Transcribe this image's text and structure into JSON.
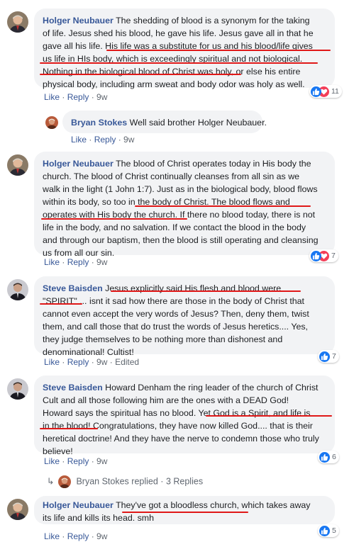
{
  "colors": {
    "author": "#385898",
    "bubble": "#f2f3f5",
    "like": "#1877f2",
    "love": "#f33e58",
    "underline": "#e01818"
  },
  "comments": [
    {
      "author": "Holger Neubauer",
      "lines": [
        "The shedding of blood is a synonym for the taking",
        "of life. Jesus shed his blood, he gave his life. Jesus gave all in that he",
        "gave all his life. His life was a substitute for us and his blood/life gives",
        "us life in HIs body, which is exceedingly spiritual and not biological.",
        "Nothing in the biological blood of Christ was holy, or else his entire",
        "physical body, including arm sweat and body odor was holy as well."
      ],
      "actions": {
        "like": "Like",
        "reply": "Reply",
        "time": "9w"
      },
      "reactions": {
        "icons": [
          "like-icon",
          "love-icon"
        ],
        "count": "11"
      }
    },
    {
      "author": "Bryan Stokes",
      "lines": [
        "Well said brother Holger Neubauer."
      ],
      "actions": {
        "like": "Like",
        "reply": "Reply",
        "time": "9w"
      }
    },
    {
      "author": "Holger Neubauer",
      "lines": [
        "The blood of Christ operates today in His body the",
        "church. The blood of Christ continually cleanses from all sin as we",
        "walk in the light (1 John 1:7). Just as in the biological body, blood flows",
        "within its body, so too in the body of Christ. The blood flows and",
        "operates with His body the church. If there no blood today, there is not",
        "life in the body, and no salvation. If we contact the blood in the body",
        "and through our baptism, then the blood is still operating and cleansing",
        "us from all our sin."
      ],
      "actions": {
        "like": "Like",
        "reply": "Reply",
        "time": "9w"
      },
      "reactions": {
        "icons": [
          "like-icon",
          "love-icon"
        ],
        "count": "7"
      }
    },
    {
      "author": "Steve Baisden",
      "lines": [
        "Jesus explicitly said His flesh and blood were",
        "\"SPIRIT\" ... isnt it sad how there are those in the body of Christ that",
        "cannot even accept the very words of Jesus? Then, deny them, twist",
        "them, and call those that do trust the words of Jesus heretics.... Yes,",
        "they judge themselves to be nothing more than dishonest and",
        "denominational! Cultist!"
      ],
      "actions": {
        "like": "Like",
        "reply": "Reply",
        "time": "9w",
        "edited": "Edited"
      },
      "reactions": {
        "icons": [
          "like-icon"
        ],
        "count": "7"
      }
    },
    {
      "author": "Steve Baisden",
      "lines": [
        "Howard Denham the ring leader of the church of Christ",
        "Cult and all those following him are the ones with a DEAD God!",
        "Howard says the spiritual has no blood. Yet God is a Spirit, and life is",
        "in the blood! Congratulations, they have now killed God.... that is their",
        "heretical doctrine! And they have the nerve to condemn those who truly",
        "believe!"
      ],
      "actions": {
        "like": "Like",
        "reply": "Reply",
        "time": "9w"
      },
      "reactions": {
        "icons": [
          "like-icon"
        ],
        "count": "6"
      },
      "replies": {
        "name": "Bryan Stokes",
        "text": "replied",
        "sep": "·",
        "count": "3 Replies"
      }
    },
    {
      "author": "Holger Neubauer",
      "lines": [
        "They've got a bloodless church, which takes away",
        "its life and kills its head. smh"
      ],
      "actions": {
        "like": "Like",
        "reply": "Reply",
        "time": "9w"
      },
      "reactions": {
        "icons": [
          "like-icon"
        ],
        "count": "5"
      }
    }
  ]
}
